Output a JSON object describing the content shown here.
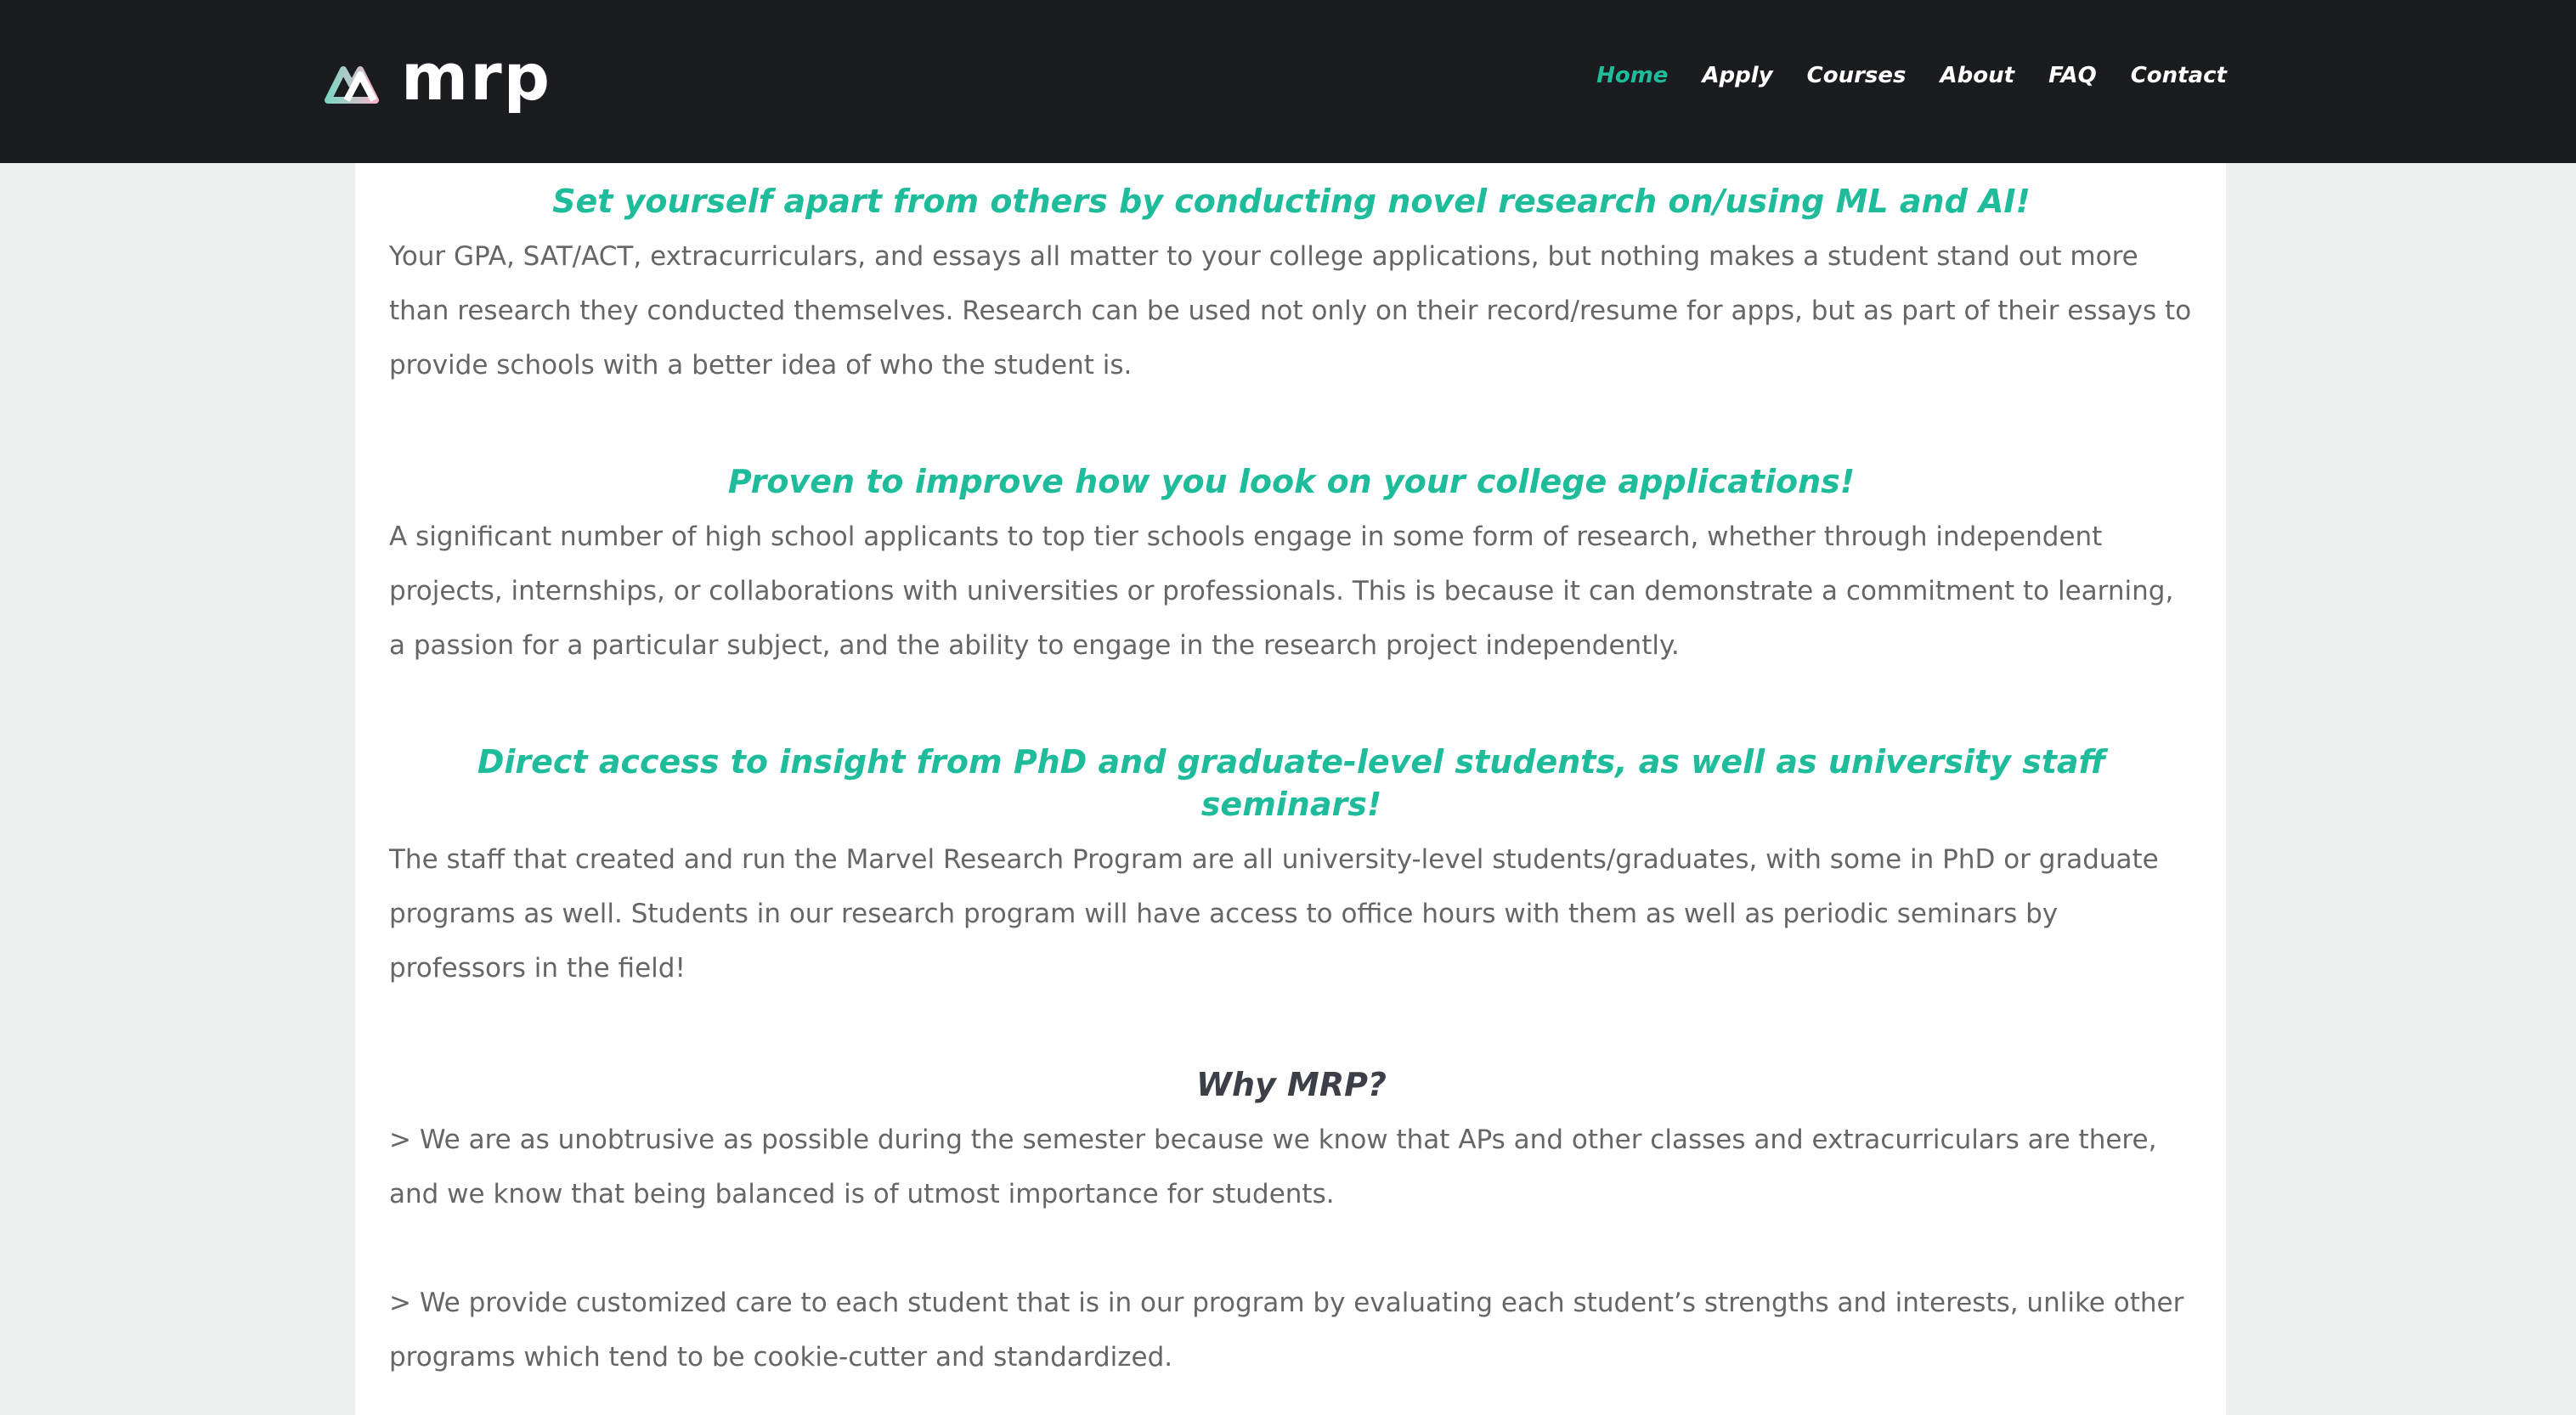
{
  "header": {
    "logo_text": "mrp",
    "nav": [
      {
        "label": "Home",
        "active": true
      },
      {
        "label": "Apply",
        "active": false
      },
      {
        "label": "Courses",
        "active": false
      },
      {
        "label": "About",
        "active": false
      },
      {
        "label": "FAQ",
        "active": false
      },
      {
        "label": "Contact",
        "active": false
      }
    ]
  },
  "colors": {
    "accent": "#1ebc9b",
    "header_bg": "#1b1c20",
    "page_bg": "#ecf0ef",
    "body_text": "#666666",
    "dark_heading": "#3c3f47"
  },
  "main": {
    "sections": [
      {
        "heading": "Set yourself apart from others by conducting novel research on/using ML and AI!",
        "body": "Your GPA, SAT/ACT, extracurriculars, and essays all matter to your college applications, but nothing makes a student stand out more than research they conducted themselves. Research can be used not only on their record/resume for apps, but as part of their essays to provide schools with a better idea of who the student is."
      },
      {
        "heading": "Proven to improve how you look on your college applications!",
        "body": "A significant number of high school applicants to top tier schools engage in some form of research, whether through independent projects, internships, or collaborations with universities or professionals. This is because it can demonstrate a commitment to learning, a passion for a particular subject, and the ability to engage in the research project independently."
      },
      {
        "heading": "Direct access to insight from PhD and graduate-level students, as well as university staff seminars!",
        "body": "The staff that created and run the Marvel Research Program are all university-level students/graduates, with some in PhD or graduate programs as well. Students in our research program will have access to office hours with them as well as periodic seminars by professors in the field!"
      }
    ],
    "why": {
      "heading": "Why MRP?",
      "points": [
        "> We are as unobtrusive as possible during the semester because we know that APs and other classes and extracurriculars are there, and we know that being balanced is of utmost importance for students.",
        "> We provide customized care to each student that is in our program by evaluating each student’s strengths and interests, unlike other programs which tend to be cookie-cutter and standardized."
      ]
    }
  }
}
